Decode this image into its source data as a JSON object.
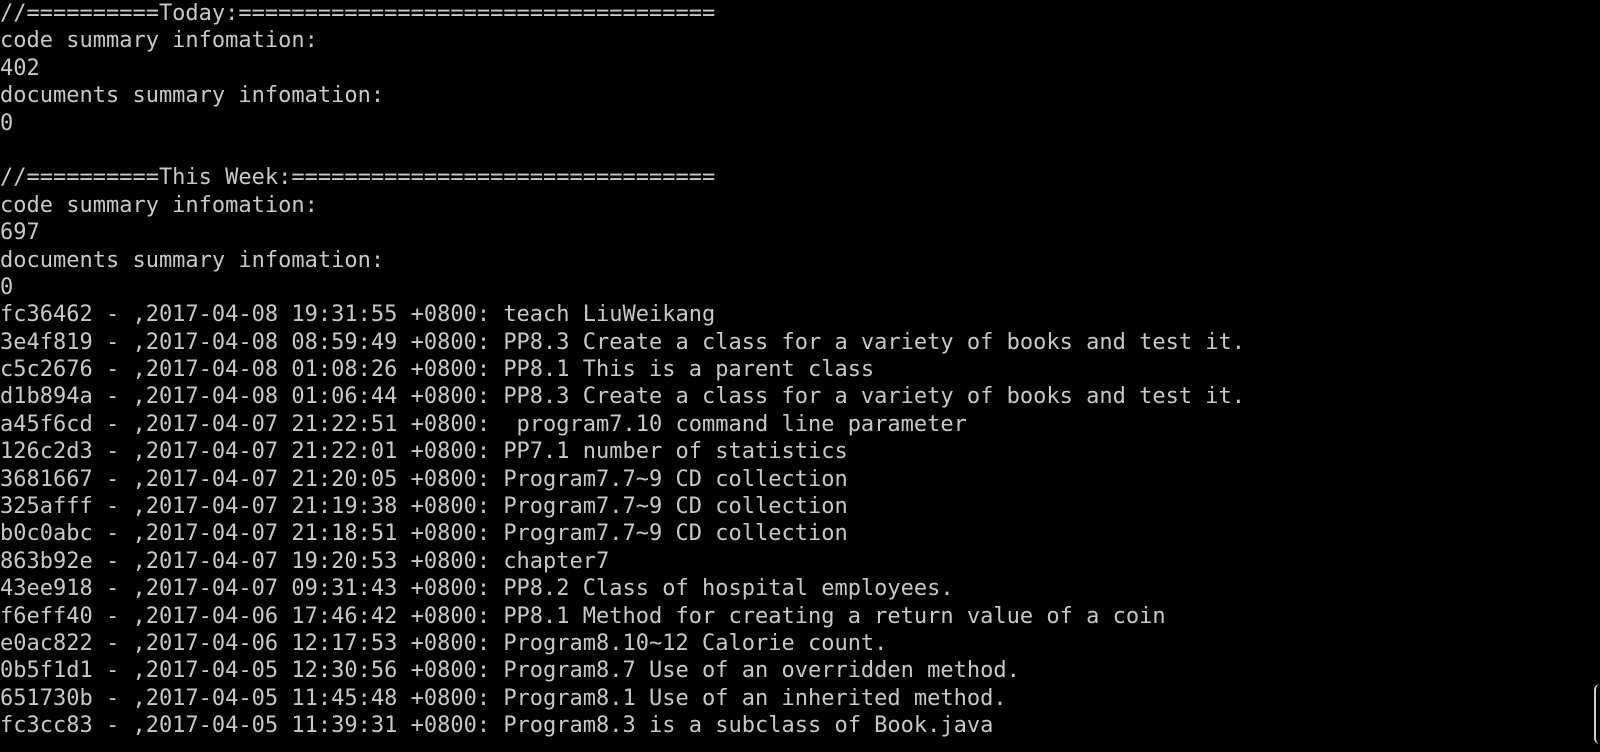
{
  "sections": {
    "today": {
      "header": "//==========Today:====================================",
      "code_label": "code summary infomation:",
      "code_value": "402",
      "docs_label": "documents summary infomation:",
      "docs_value": "0"
    },
    "week": {
      "header": "//==========This Week:================================",
      "code_label": "code summary infomation:",
      "code_value": "697",
      "docs_label": "documents summary infomation:",
      "docs_value": "0"
    }
  },
  "commits": [
    "fc36462 - ,2017-04-08 19:31:55 +0800: teach LiuWeikang",
    "3e4f819 - ,2017-04-08 08:59:49 +0800: PP8.3 Create a class for a variety of books and test it.",
    "c5c2676 - ,2017-04-08 01:08:26 +0800: PP8.1 This is a parent class",
    "d1b894a - ,2017-04-08 01:06:44 +0800: PP8.3 Create a class for a variety of books and test it.",
    "a45f6cd - ,2017-04-07 21:22:51 +0800:  program7.10 command line parameter",
    "126c2d3 - ,2017-04-07 21:22:01 +0800: PP7.1 number of statistics",
    "3681667 - ,2017-04-07 21:20:05 +0800: Program7.7~9 CD collection",
    "325afff - ,2017-04-07 21:19:38 +0800: Program7.7~9 CD collection",
    "b0c0abc - ,2017-04-07 21:18:51 +0800: Program7.7~9 CD collection",
    "863b92e - ,2017-04-07 19:20:53 +0800: chapter7",
    "43ee918 - ,2017-04-07 09:31:43 +0800: PP8.2 Class of hospital employees.",
    "f6eff40 - ,2017-04-06 17:46:42 +0800: PP8.1 Method for creating a return value of a coin",
    "e0ac822 - ,2017-04-06 12:17:53 +0800: Program8.10~12 Calorie count.",
    "0b5f1d1 - ,2017-04-05 12:30:56 +0800: Program8.7 Use of an overridden method.",
    "651730b - ,2017-04-05 11:45:48 +0800: Program8.1 Use of an inherited method.",
    "fc3cc83 - ,2017-04-05 11:39:31 +0800: Program8.3 is a subclass of Book.java"
  ],
  "colors": {
    "background": "#000000",
    "text": "#c8c8c8"
  }
}
